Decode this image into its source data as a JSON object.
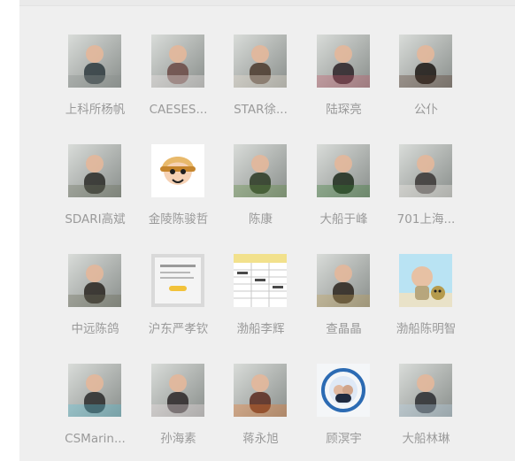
{
  "contacts": [
    {
      "name": "上科所杨帆",
      "icon": "man-by-wall-photo-icon",
      "colors": [
        "#8a8f8c",
        "#d9dcd9",
        "#2f3b3f"
      ]
    },
    {
      "name": "CAESES...",
      "icon": "dog-face-photo-icon",
      "colors": [
        "#f2e8e8",
        "#d9a09a",
        "#6b4a45"
      ]
    },
    {
      "name": "STAR徐...",
      "icon": "baby-photo-icon",
      "colors": [
        "#efe3d3",
        "#d7b48f",
        "#4b3a2d"
      ]
    },
    {
      "name": "陆琛亮",
      "icon": "couple-poster-photo-icon",
      "colors": [
        "#c75a6a",
        "#f0d2d8",
        "#2b2227"
      ]
    },
    {
      "name": "公仆",
      "icon": "man-portrait-photo-icon",
      "colors": [
        "#5a3c2e",
        "#c18a62",
        "#1c1714"
      ]
    },
    {
      "name": "SDARI高斌",
      "icon": "house-garden-photo-icon",
      "colors": [
        "#6a6f5d",
        "#b9c2b7",
        "#2b2c28"
      ]
    },
    {
      "name": "金陵陈骏哲",
      "icon": "cartoon-boy-icon",
      "colors": [
        "#ffffff",
        "#e8b96b",
        "#1f1f1f"
      ]
    },
    {
      "name": "陈康",
      "icon": "man-in-park-photo-icon",
      "colors": [
        "#5e8b3e",
        "#c2d6b6",
        "#2b3a23"
      ]
    },
    {
      "name": "大船于峰",
      "icon": "couple-in-field-photo-icon",
      "colors": [
        "#3a7a34",
        "#c9d9b7",
        "#1f2b1c"
      ]
    },
    {
      "name": "701上海...",
      "icon": "baby-lying-photo-icon",
      "colors": [
        "#f3efe8",
        "#e6c2a9",
        "#3a3635"
      ]
    },
    {
      "name": "中远陈鸽",
      "icon": "person-in-garden-photo-icon",
      "colors": [
        "#6b6a57",
        "#b7b08b",
        "#2a2621"
      ]
    },
    {
      "name": "沪东严孝钦",
      "icon": "document-screenshot-icon",
      "colors": [
        "#d9d9d9",
        "#f4f4f4",
        "#9a9a9a"
      ]
    },
    {
      "name": "渤船李辉",
      "icon": "table-screenshot-icon",
      "colors": [
        "#f2e18c",
        "#c9c9c9",
        "#4a4a4a"
      ]
    },
    {
      "name": "查晶晶",
      "icon": "woman-in-cafe-photo-icon",
      "colors": [
        "#c7a45a",
        "#efe2c3",
        "#2b241d"
      ]
    },
    {
      "name": "渤船陈明智",
      "icon": "cartoon-grandpa-dog-icon",
      "colors": [
        "#b9e3f3",
        "#e7c1a4",
        "#b59b4d"
      ]
    },
    {
      "name": "CSMarin...",
      "icon": "dog-with-glasses-photo-icon",
      "colors": [
        "#58c2d9",
        "#e9e7e1",
        "#2a2a2a"
      ]
    },
    {
      "name": "孙海素",
      "icon": "kids-on-bed-photo-icon",
      "colors": [
        "#f1e3e4",
        "#d9b2b7",
        "#2b2728"
      ]
    },
    {
      "name": "蒋永旭",
      "icon": "athlete-photo-icon",
      "colors": [
        "#f27a2b",
        "#f3c7a0",
        "#5b2a1f"
      ]
    },
    {
      "name": "顾溟宇",
      "icon": "university-seal-photo-icon",
      "colors": [
        "#f4f6f8",
        "#2c6bb3",
        "#1e2a40"
      ]
    },
    {
      "name": "大船林琳",
      "icon": "man-in-harbor-photo-icon",
      "colors": [
        "#b7d0e6",
        "#f0f4f7",
        "#2b2d30"
      ]
    }
  ]
}
